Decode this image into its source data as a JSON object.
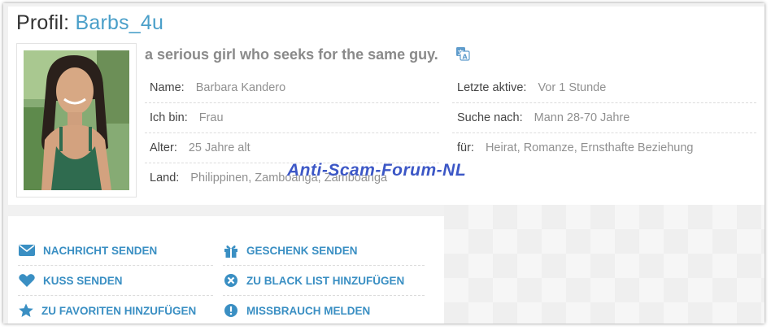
{
  "profile": {
    "title_prefix": "Profil:",
    "username": "Barbs_4u",
    "headline": "a serious girl who seeks for the same guy.",
    "left_fields": [
      {
        "label": "Name:",
        "value": "Barbara Kandero"
      },
      {
        "label": "Ich bin:",
        "value": "Frau"
      },
      {
        "label": "Alter:",
        "value": "25 Jahre alt"
      },
      {
        "label": "Land:",
        "value": "Philippinen, Zamboanga, Zamboanga"
      }
    ],
    "right_fields": [
      {
        "label": "Letzte aktive:",
        "value": "Vor 1 Stunde"
      },
      {
        "label": "Suche nach:",
        "value": "Mann 28-70 Jahre"
      },
      {
        "label": "für:",
        "value": "Heirat, Romanze, Ernsthafte Beziehung"
      }
    ]
  },
  "watermark": "Anti-Scam-Forum-NL",
  "actions": {
    "send_message": "NACHRICHT SENDEN",
    "send_gift": "GESCHENK SENDEN",
    "send_kiss": "KUSS SENDEN",
    "add_blacklist": "ZU BLACK LIST HINZUFÜGEN",
    "add_favorites": "ZU FAVORITEN HINZUFÜGEN",
    "report_abuse": "MISSBRAUCH MELDEN"
  },
  "colors": {
    "accent": "#4a9fc9",
    "link": "#3a8fc3",
    "watermark": "#3c57c6"
  },
  "icons": [
    "translate-icon",
    "envelope-icon",
    "gift-icon",
    "heart-icon",
    "block-icon",
    "star-icon",
    "alert-icon"
  ]
}
